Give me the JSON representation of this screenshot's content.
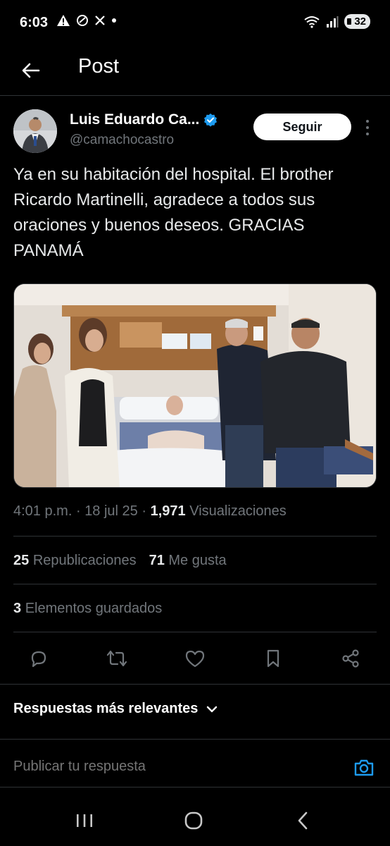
{
  "status_bar": {
    "time": "6:03",
    "left_icons": [
      "warning-icon",
      "shield-icon",
      "x-logo-icon",
      "dot-icon"
    ],
    "right_icons": [
      "wifi-icon",
      "signal-icon"
    ],
    "battery": "32"
  },
  "header": {
    "title": "Post",
    "back_icon": "arrow-left-icon"
  },
  "author": {
    "name": "Luis Eduardo Ca...",
    "handle": "@camachocastro",
    "verified": true,
    "follow_label": "Seguir"
  },
  "post": {
    "text": "Ya en su habitación del hospital. El brother Ricardo Martinelli, agradece a todos sus oraciones y buenos deseos. GRACIAS PANAMÁ",
    "image_description_icon": "photo"
  },
  "meta": {
    "time": "4:01 p.m.",
    "sep1": "·",
    "date": "18 jul 25",
    "sep2": "·",
    "views_count": "1,971",
    "views_label": "Visualizaciones"
  },
  "stats": {
    "reposts_count": "25",
    "reposts_label": "Republicaciones",
    "likes_count": "71",
    "likes_label": "Me gusta",
    "bookmarks_count": "3",
    "bookmarks_label": "Elementos guardados"
  },
  "actions": [
    "reply-icon",
    "repost-icon",
    "like-icon",
    "bookmark-icon",
    "share-icon"
  ],
  "replies": {
    "sort_label": "Respuestas más relevantes",
    "reply_placeholder": "Publicar tu respuesta"
  },
  "colors": {
    "background": "#000000",
    "text": "#e7e9ea",
    "muted": "#71767b",
    "accent": "#1d9bf0",
    "divider": "#2f3336"
  }
}
